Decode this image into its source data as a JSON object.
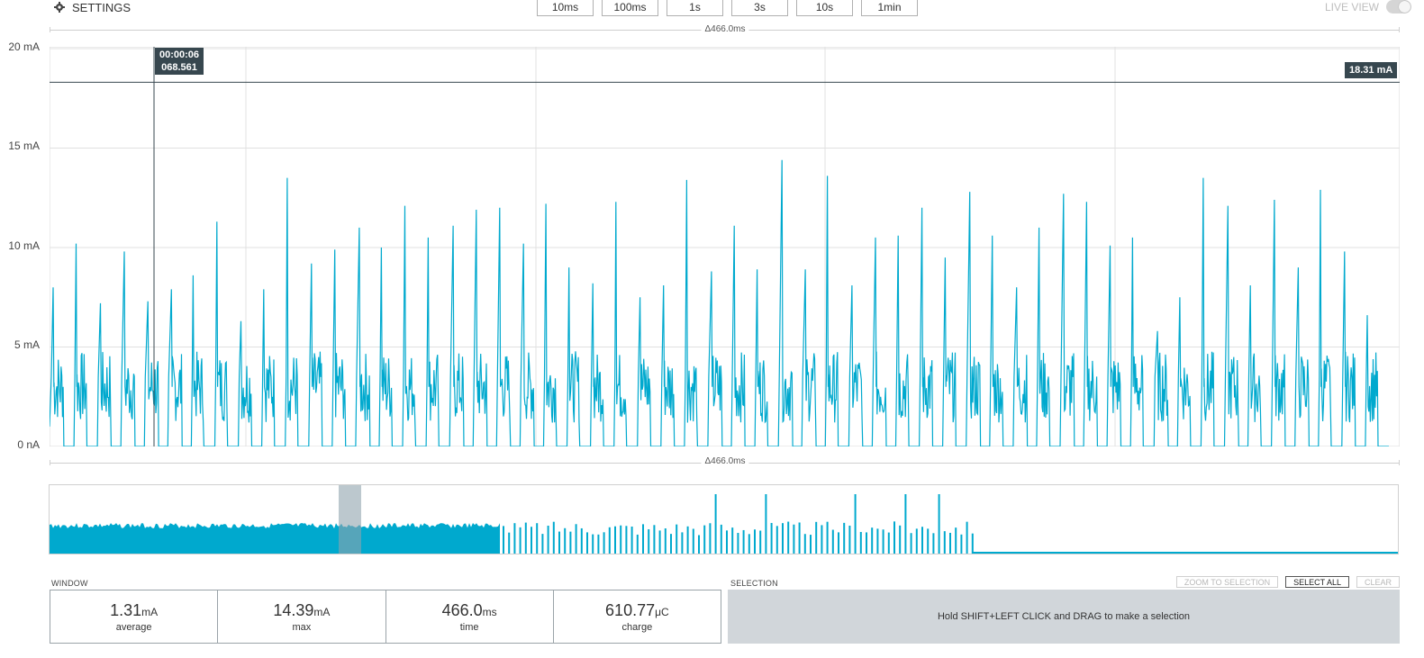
{
  "header": {
    "settings_label": "SETTINGS",
    "window_buttons": [
      "10ms",
      "100ms",
      "1s",
      "3s",
      "10s",
      "1min"
    ],
    "live_view_label": "LIVE VIEW",
    "live_view_on": false
  },
  "delta_label": "Δ466.0ms",
  "cursor": {
    "time_line1": "00:00:06",
    "time_line2": "068.561",
    "value_label": "18.31 mA"
  },
  "colors": {
    "trace": "#00a9ce",
    "grid": "#e0e0e0",
    "cursor": "#37474f",
    "selection_bg": "#d1d6da"
  },
  "chart_data": {
    "type": "line",
    "ylabel": "",
    "yticks": [
      "0 nA",
      "5 mA",
      "10 mA",
      "15 mA",
      "20 mA"
    ],
    "ylim": [
      0,
      20
    ],
    "x_window_ms": 466.0,
    "cursor_value": 18.31,
    "peaks_mA": [
      8.0,
      10.2,
      7.2,
      9.8,
      7.3,
      7.9,
      8.6,
      11.3,
      6.3,
      7.9,
      13.5,
      9.2,
      9.9,
      11.0,
      10.0,
      12.1,
      10.5,
      11.1,
      11.9,
      12.0,
      10.2,
      12.2,
      9.0,
      8.2,
      12.3,
      7.5,
      8.1,
      13.4,
      8.8,
      11.1,
      8.9,
      14.4,
      8.9,
      13.6,
      8.1,
      10.5,
      10.6,
      12.0,
      9.5,
      12.8,
      10.6,
      8.0,
      11.0,
      12.7,
      12.3,
      10.1,
      10.5,
      5.8,
      7.5,
      13.5,
      12.1,
      8.1,
      12.4,
      9.0,
      12.9,
      9.8,
      6.6
    ],
    "window_stats": {
      "average": "1.31",
      "average_unit": "mA",
      "max": "14.39",
      "max_unit": "mA",
      "time": "466.0",
      "time_unit": "ms",
      "charge": "610.77",
      "charge_unit": "μC"
    }
  },
  "window_section": {
    "label": "WINDOW",
    "captions": [
      "average",
      "max",
      "time",
      "charge"
    ]
  },
  "selection_section": {
    "label": "SELECTION",
    "buttons": [
      "ZOOM TO SELECTION",
      "SELECT ALL",
      "CLEAR"
    ],
    "hint": "Hold SHIFT+LEFT CLICK and DRAG to make a selection"
  }
}
